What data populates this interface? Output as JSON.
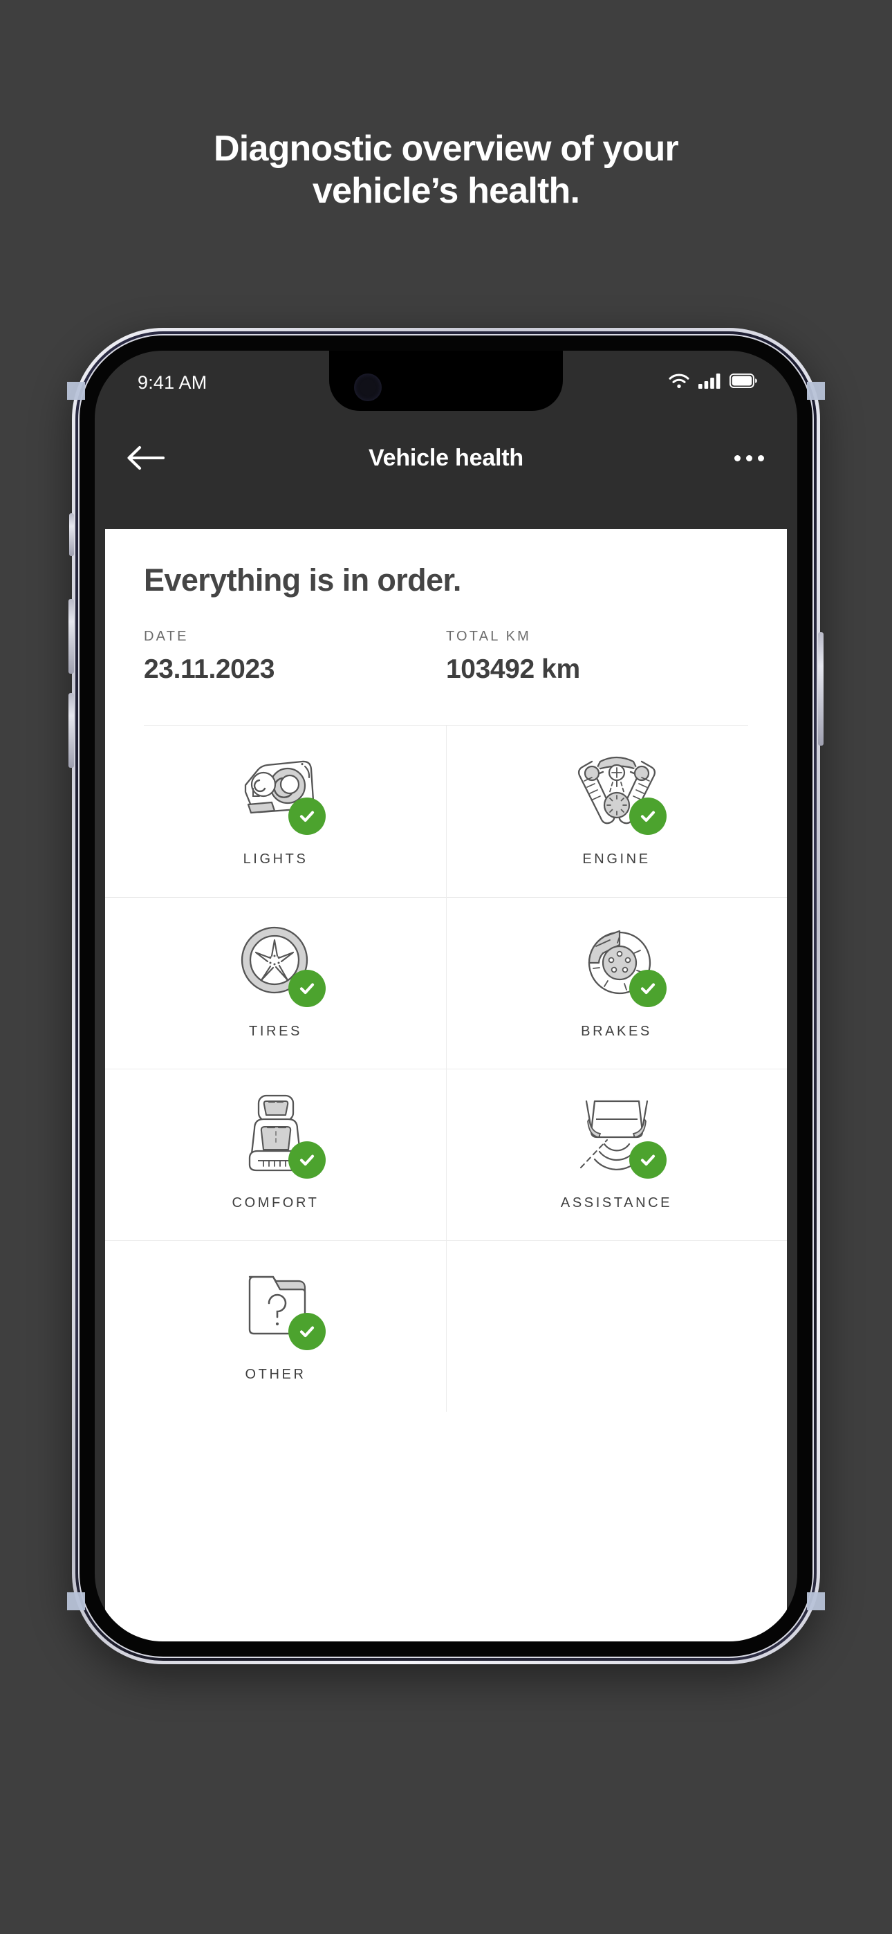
{
  "promo": {
    "headline_line1": "Diagnostic overview of your",
    "headline_line2": "vehicle’s health."
  },
  "status_bar": {
    "time": "9:41 AM",
    "wifi_icon": "wifi-icon",
    "cellular_icon": "cellular-signal-icon",
    "battery_icon": "battery-full-icon"
  },
  "nav": {
    "back_icon": "arrow-left-icon",
    "title": "Vehicle health",
    "more_icon": "overflow-menu-icon"
  },
  "card": {
    "title": "Everything is in order.",
    "stats": [
      {
        "label": "DATE",
        "value": "23.11.2023"
      },
      {
        "label": "TOTAL KM",
        "value": "103492 km"
      }
    ]
  },
  "checks": [
    {
      "label": "LIGHTS",
      "icon": "headlight-icon",
      "status": "ok",
      "badge_icon": "check-circle-icon"
    },
    {
      "label": "ENGINE",
      "icon": "engine-icon",
      "status": "ok",
      "badge_icon": "check-circle-icon"
    },
    {
      "label": "TIRES",
      "icon": "tire-wheel-icon",
      "status": "ok",
      "badge_icon": "check-circle-icon"
    },
    {
      "label": "BRAKES",
      "icon": "brake-disc-icon",
      "status": "ok",
      "badge_icon": "check-circle-icon"
    },
    {
      "label": "COMFORT",
      "icon": "car-seat-icon",
      "status": "ok",
      "badge_icon": "check-circle-icon"
    },
    {
      "label": "ASSISTANCE",
      "icon": "parking-sensor-icon",
      "status": "ok",
      "badge_icon": "check-circle-icon"
    },
    {
      "label": "OTHER",
      "icon": "folder-question-icon",
      "status": "ok",
      "badge_icon": "check-circle-icon"
    }
  ],
  "colors": {
    "page_background": "#3f3f3f",
    "status_ok_green": "#4CA32E",
    "card_background": "#ffffff",
    "screen_background": "#2e2e2e",
    "text_dark": "#3f3f3f",
    "divider": "#ececec"
  }
}
